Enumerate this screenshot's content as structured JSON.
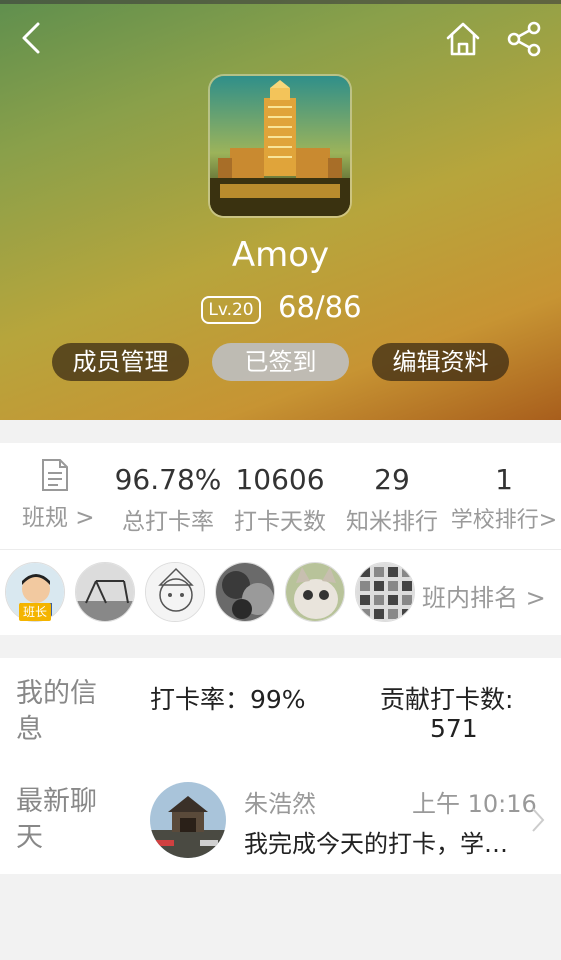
{
  "profile": {
    "name": "Amoy",
    "level": "Lv.20",
    "progress": "68/86"
  },
  "actions": {
    "member_manage": "成员管理",
    "checked_in": "已签到",
    "edit_profile": "编辑资料"
  },
  "stats": {
    "rules_label": "班规 >",
    "items": [
      {
        "value": "96.78%",
        "label": "总打卡率"
      },
      {
        "value": "10606",
        "label": "打卡天数"
      },
      {
        "value": "29",
        "label": "知米排行"
      },
      {
        "value": "1",
        "label": "学校排行>"
      }
    ]
  },
  "members": {
    "monitor_tag": "班长",
    "class_rank_link": "班内排名 >"
  },
  "my_info": {
    "label": "我的信息",
    "checkin_rate": "打卡率：99%",
    "contribution_label": "贡献打卡数:",
    "contribution_value": "571"
  },
  "latest_chat": {
    "label": "最新聊天",
    "sender": "朱浩然",
    "time": "上午 10:16",
    "message": "我完成今天的打卡，学习了新的单词"
  },
  "colors": {
    "hero_start": "#5f8f4e",
    "hero_end": "#a85e1c",
    "pill_dark": "#37281488",
    "tag": "#f4b400"
  }
}
